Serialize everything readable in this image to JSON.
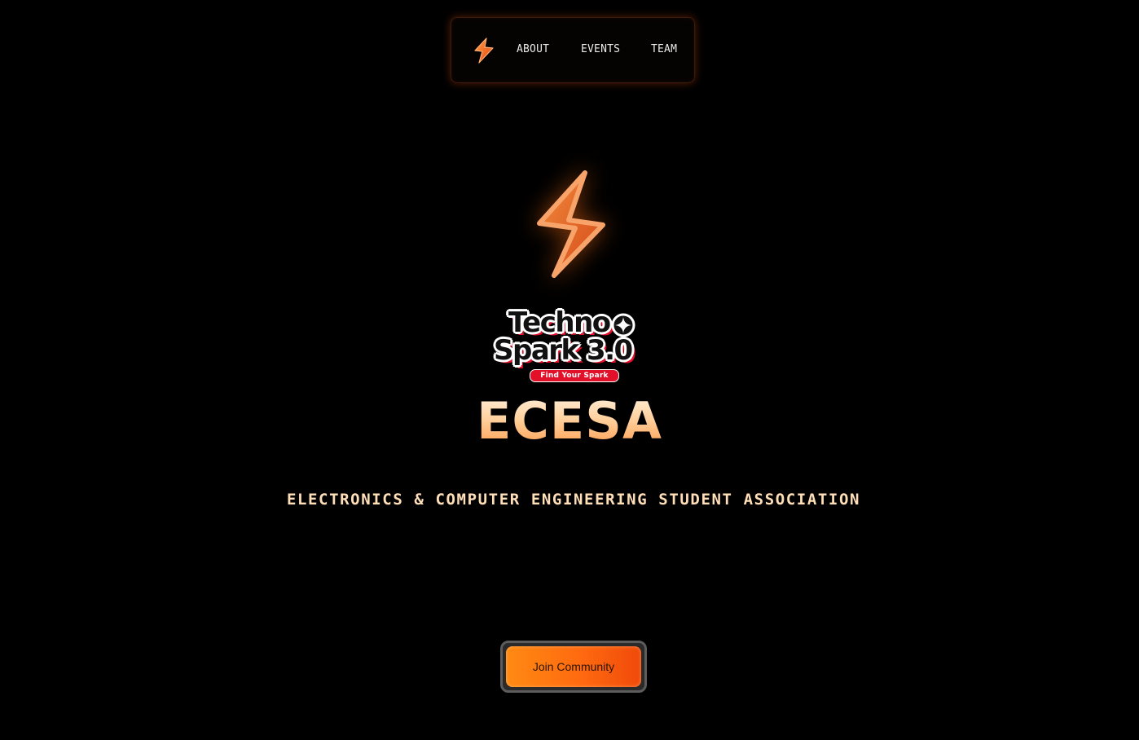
{
  "nav": {
    "logo_icon": "lightning-bolt-icon",
    "links": [
      {
        "label": "ABOUT"
      },
      {
        "label": "EVENTS"
      },
      {
        "label": "TEAM"
      }
    ]
  },
  "hero": {
    "bolt_icon": "lightning-bolt-icon",
    "event_logo": {
      "line1": "Techno",
      "line2": "Spark 3.0",
      "tagline": "Find Your Spark"
    },
    "title": "ECESA",
    "subtitle": "ELECTRONICS & COMPUTER ENGINEERING STUDENT ASSOCIATION",
    "cta_label": "Join Community"
  },
  "colors": {
    "background": "#000000",
    "accent": "#ff6a10",
    "subtitle_text": "#ffdfb8",
    "logo_red": "#e3102a"
  }
}
